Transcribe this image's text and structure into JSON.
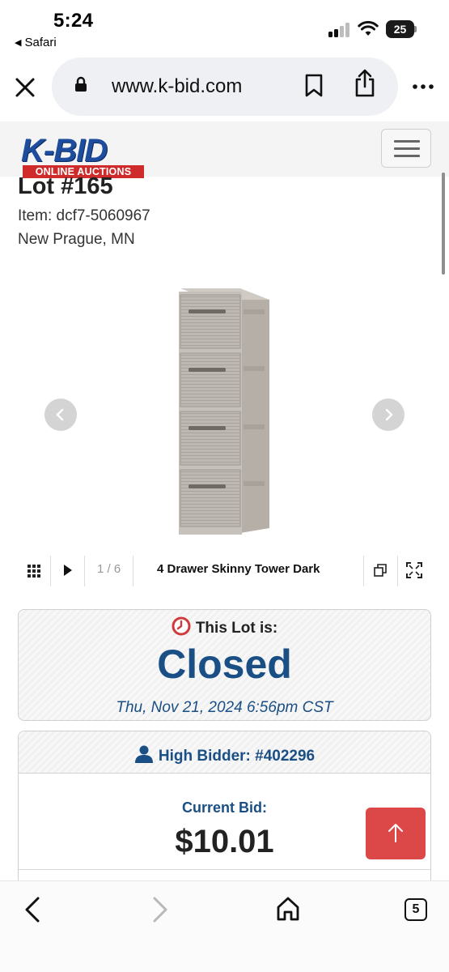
{
  "status_bar": {
    "time": "5:24",
    "back_app": "Safari",
    "battery": "25"
  },
  "browser": {
    "url": "www.k-bid.com"
  },
  "site": {
    "logo_text": "K-BID",
    "logo_subtext": "ONLINE AUCTIONS"
  },
  "lot": {
    "title": "Lot #165",
    "item": "Item: dcf7-5060967",
    "location": "New Prague, MN"
  },
  "gallery": {
    "counter": "1 / 6",
    "caption": "4 Drawer Skinny Tower Dark"
  },
  "status": {
    "label": "This Lot is:",
    "state": "Closed",
    "closed_at": "Thu, Nov 21, 2024 6:56pm CST"
  },
  "bidding": {
    "high_bidder": "High Bidder: #402296",
    "current_label": "Current Bid:",
    "current_value": "$10.01"
  },
  "bottom_bar": {
    "tab_count": "5"
  },
  "colors": {
    "brand_blue": "#1a4f86",
    "logo_red": "#d02b2b",
    "scroll_top_red": "#dc4747",
    "clock_red": "#d13a3a"
  },
  "icons": [
    "close-icon",
    "lock-icon",
    "bookmark-icon",
    "share-icon",
    "more-icon",
    "menu-icon",
    "prev-icon",
    "next-icon",
    "grid-icon",
    "play-icon",
    "copy-icon",
    "expand-icon",
    "clock-icon",
    "person-icon",
    "arrow-up-icon",
    "back-icon",
    "forward-icon",
    "home-icon",
    "tabs-icon"
  ]
}
